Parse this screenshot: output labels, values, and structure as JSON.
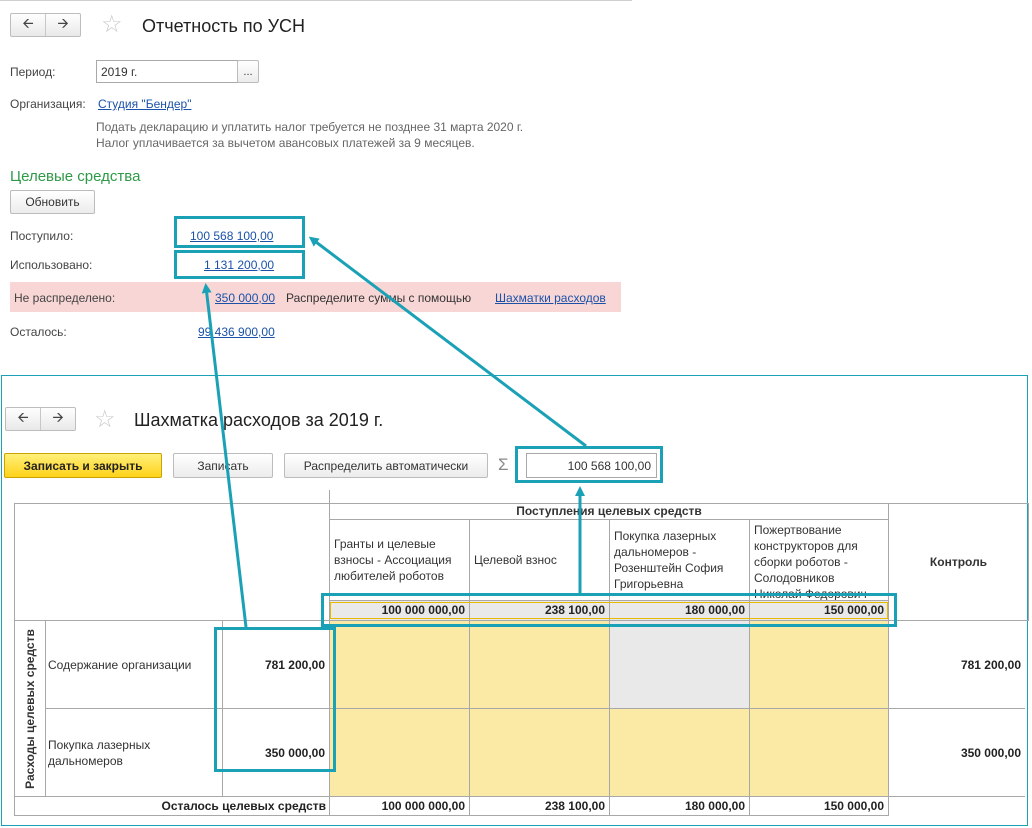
{
  "report": {
    "title": "Отчетность по УСН",
    "period_label": "Период:",
    "period_value": "2019 г.",
    "period_btn": "...",
    "org_label": "Организация:",
    "org_value": "Студия \"Бендер\"",
    "note1": "Подать декларацию и уплатить налог требуется не позднее 31 марта 2020 г.",
    "note2": "Налог уплачивается за вычетом авансовых платежей за 9 месяцев.",
    "section_title": "Целевые средства",
    "refresh_btn": "Обновить",
    "received_label": "Поступило:",
    "received_value": "100 568 100,00",
    "used_label": "Использовано:",
    "used_value": "1 131 200,00",
    "unallocated_label": "Не распределено:",
    "unallocated_value": "350 000,00",
    "distribute_text": "Распределите суммы с помощью",
    "distribute_link": "Шахматки расходов",
    "remaining_label": "Осталось:",
    "remaining_value": "99 436 900,00"
  },
  "matrix": {
    "title": "Шахматка расходов за 2019 г.",
    "save_close_btn": "Записать и закрыть",
    "save_btn": "Записать",
    "auto_btn": "Распределить автоматически",
    "sigma": "Σ",
    "total": "100 568 100,00",
    "group_header": "Поступления целевых средств",
    "control_header": "Контроль",
    "vertical_header": "Расходы целевых средств",
    "columns": [
      {
        "name": "Гранты и целевые взносы - Ассоциация любителей роботов",
        "amount": "100 000 000,00",
        "remaining": "100 000 000,00"
      },
      {
        "name": "Целевой взнос",
        "amount": "238 100,00",
        "remaining": "238 100,00"
      },
      {
        "name": "Покупка лазерных дальномеров - Розенштейн София Григорьевна",
        "amount": "180 000,00",
        "remaining": "180 000,00"
      },
      {
        "name": "Пожертвование конструкторов для сборки роботов - Солодовников Николай Федорович",
        "amount": "150 000,00",
        "remaining": "150 000,00"
      }
    ],
    "rows": [
      {
        "name": "Содержание организации",
        "amount": "781 200,00",
        "control": "781 200,00"
      },
      {
        "name": "Покупка лазерных дальномеров",
        "amount": "350 000,00",
        "control": "350 000,00"
      }
    ],
    "remaining_label": "Осталось целевых средств"
  },
  "colors": {
    "accent": "#1aa1b6",
    "link": "#1b52a8",
    "section": "#2e9a48",
    "alert_bg": "#f8d6d6",
    "cell_yellow": "#fbeaa5"
  }
}
